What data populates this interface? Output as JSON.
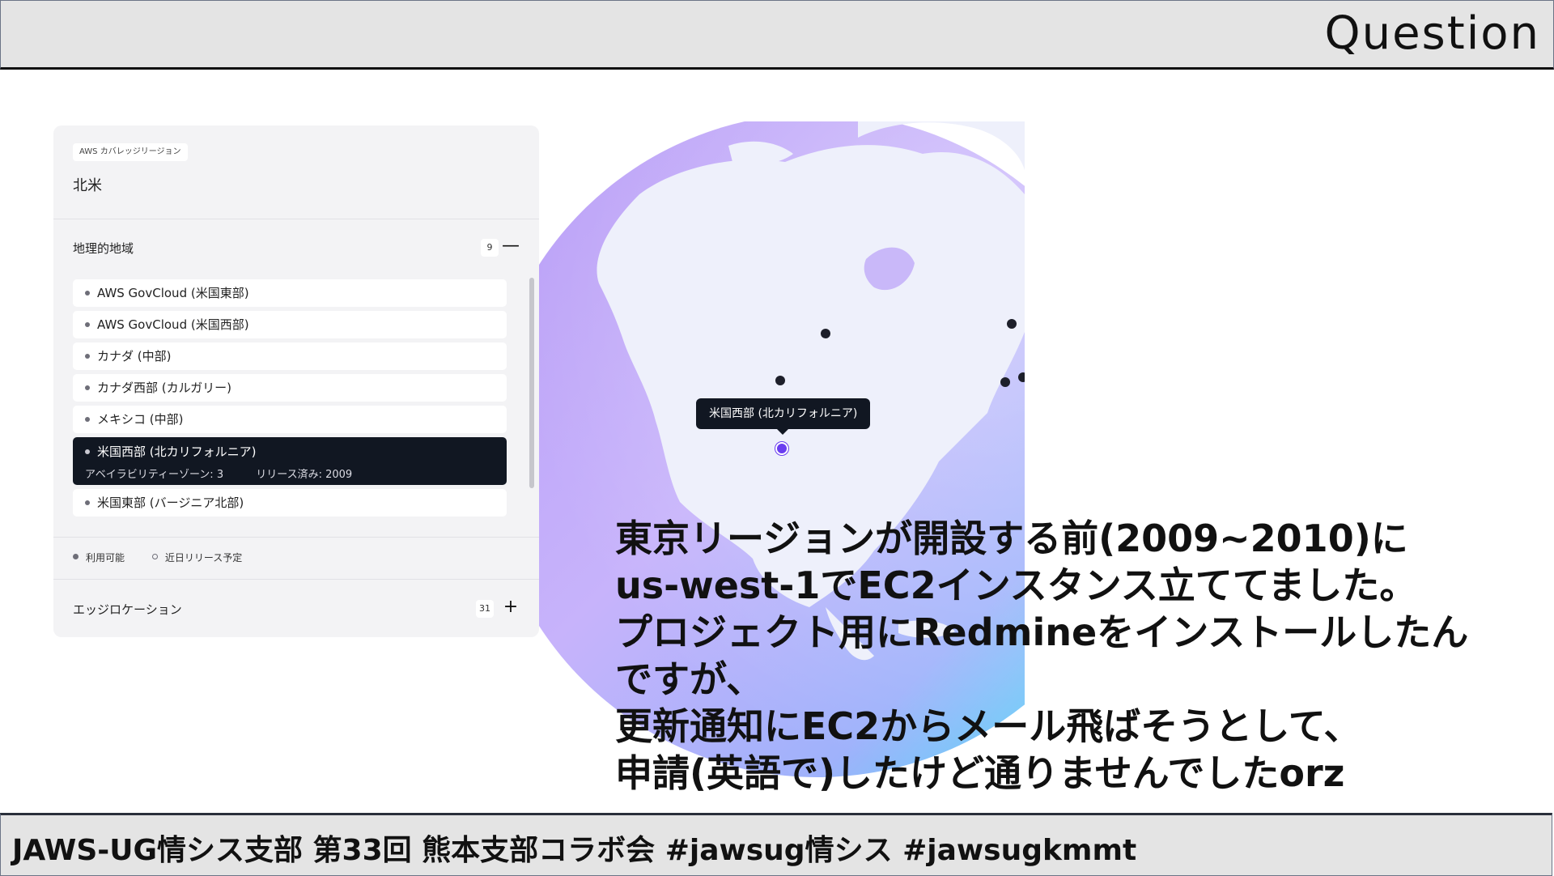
{
  "header": {
    "title": "Question"
  },
  "panel": {
    "badge": "AWS カバレッジリージョン",
    "region": "北米",
    "geo": {
      "label": "地理的地域",
      "count": "9",
      "toggle": "—"
    },
    "items": [
      {
        "label": "AWS GovCloud (米国東部)"
      },
      {
        "label": "AWS GovCloud (米国西部)"
      },
      {
        "label": "カナダ (中部)"
      },
      {
        "label": "カナダ西部 (カルガリー)"
      },
      {
        "label": "メキシコ (中部)"
      },
      {
        "label": "米国西部 (北カリフォルニア)",
        "az": "アベイラビリティーゾーン: 3",
        "release": "リリース済み: 2009"
      },
      {
        "label": "米国東部 (バージニア北部)"
      }
    ],
    "legend": {
      "available": "利用可能",
      "upcoming": "近日リリース予定"
    },
    "edge": {
      "label": "エッジロケーション",
      "count": "31",
      "toggle": "+"
    }
  },
  "map": {
    "tooltip": "米国西部 (北カリフォルニア)"
  },
  "question": {
    "lines": [
      "東京リージョンが開設する前(2009~2010)に",
      "us-west-1でEC2インスタンス立ててました。",
      "プロジェクト用にRedmineをインストールしたん",
      "ですが、",
      "更新通知にEC2からメール飛ばそうとして、",
      "申請(英語で)したけど通りませんでしたorz"
    ]
  },
  "footer": {
    "text": "JAWS-UG情シス支部 第33回 熊本支部コラボ会 #jawsug情シス #jawsugkmmt"
  },
  "colors": {
    "globe_purple": "#c3a6f7",
    "globe_cyan": "#52e4f7",
    "land": "#eef0fb",
    "panel_bg": "#f3f3f5",
    "selected_bg": "#111722"
  }
}
